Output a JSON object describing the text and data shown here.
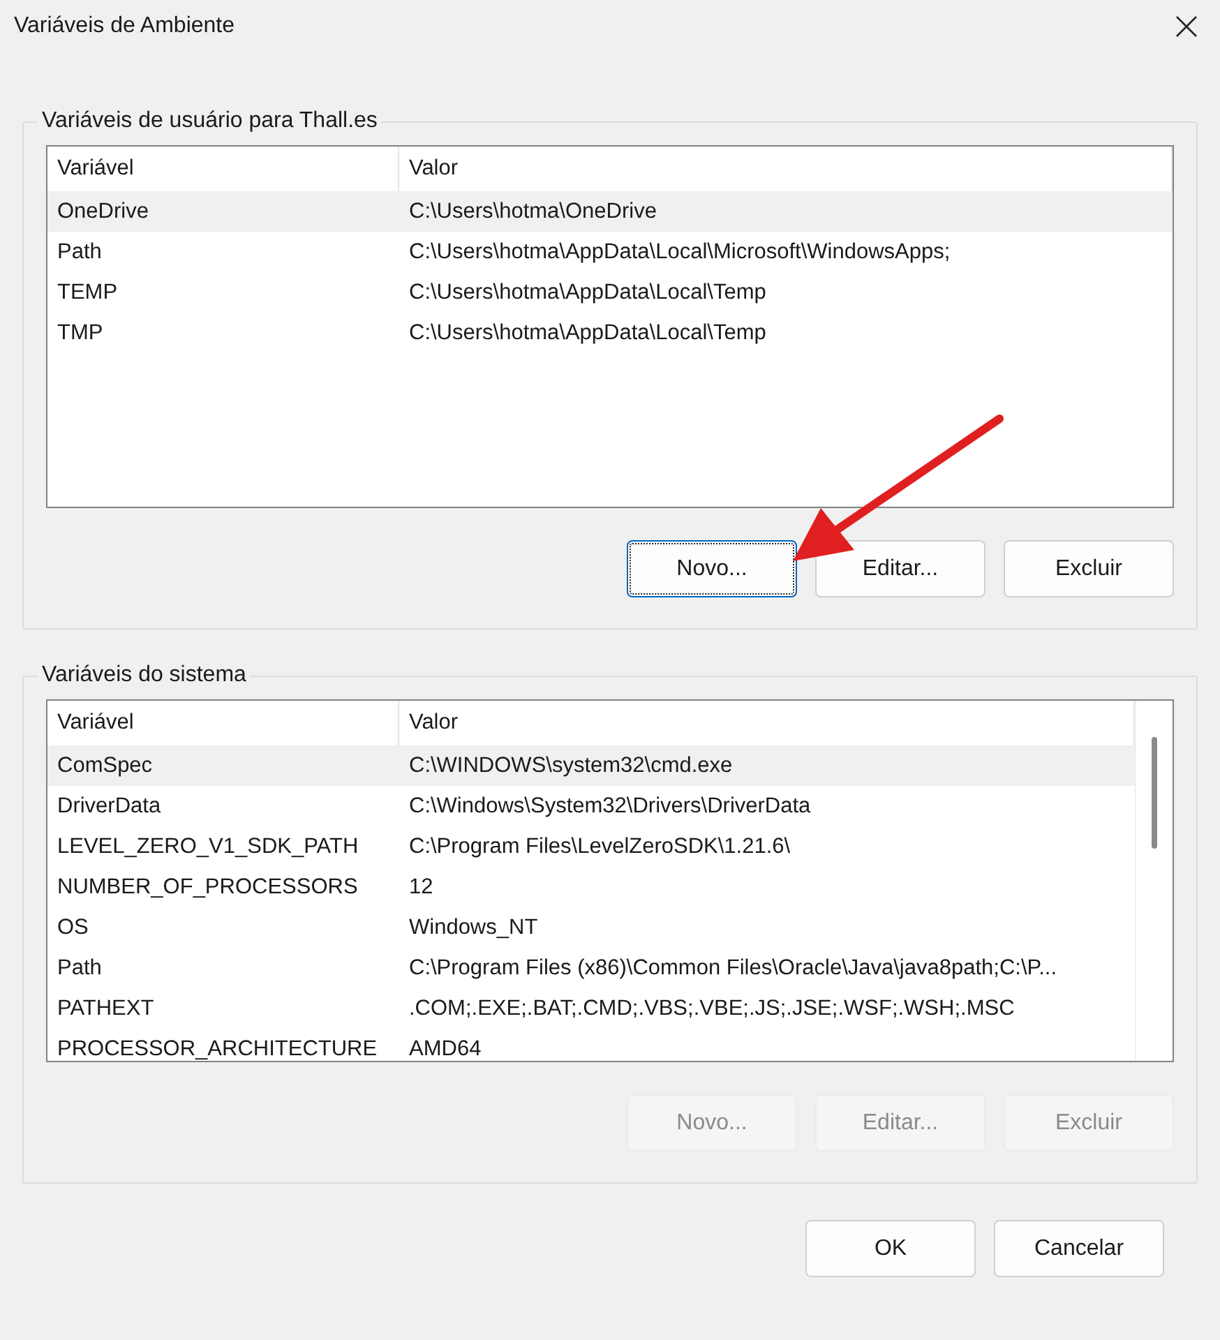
{
  "window": {
    "title": "Variáveis de Ambiente"
  },
  "user_variables": {
    "title": "Variáveis de usuário para Thall.es",
    "columns": [
      "Variável",
      "Valor"
    ],
    "rows": [
      {
        "name": "OneDrive",
        "value": "C:\\Users\\hotma\\OneDrive",
        "selected": true
      },
      {
        "name": "Path",
        "value": "C:\\Users\\hotma\\AppData\\Local\\Microsoft\\WindowsApps;",
        "selected": false
      },
      {
        "name": "TEMP",
        "value": "C:\\Users\\hotma\\AppData\\Local\\Temp",
        "selected": false
      },
      {
        "name": "TMP",
        "value": "C:\\Users\\hotma\\AppData\\Local\\Temp",
        "selected": false
      }
    ],
    "buttons": [
      {
        "label": "Novo...",
        "focused": true,
        "disabled": false
      },
      {
        "label": "Editar...",
        "focused": false,
        "disabled": false
      },
      {
        "label": "Excluir",
        "focused": false,
        "disabled": false
      }
    ]
  },
  "system_variables": {
    "title": "Variáveis do sistema",
    "columns": [
      "Variável",
      "Valor"
    ],
    "rows": [
      {
        "name": "ComSpec",
        "value": "C:\\WINDOWS\\system32\\cmd.exe",
        "selected": true
      },
      {
        "name": "DriverData",
        "value": "C:\\Windows\\System32\\Drivers\\DriverData",
        "selected": false
      },
      {
        "name": "LEVEL_ZERO_V1_SDK_PATH",
        "value": "C:\\Program Files\\LevelZeroSDK\\1.21.6\\",
        "selected": false
      },
      {
        "name": "NUMBER_OF_PROCESSORS",
        "value": "12",
        "selected": false
      },
      {
        "name": "OS",
        "value": "Windows_NT",
        "selected": false
      },
      {
        "name": "Path",
        "value": "C:\\Program Files (x86)\\Common Files\\Oracle\\Java\\java8path;C:\\P...",
        "selected": false
      },
      {
        "name": "PATHEXT",
        "value": ".COM;.EXE;.BAT;.CMD;.VBS;.VBE;.JS;.JSE;.WSF;.WSH;.MSC",
        "selected": false
      },
      {
        "name": "PROCESSOR_ARCHITECTURE",
        "value": "AMD64",
        "selected": false
      }
    ],
    "buttons": [
      {
        "label": "Novo...",
        "focused": false,
        "disabled": true
      },
      {
        "label": "Editar...",
        "focused": false,
        "disabled": true
      },
      {
        "label": "Excluir",
        "focused": false,
        "disabled": true
      }
    ]
  },
  "dialog_buttons": [
    {
      "label": "OK"
    },
    {
      "label": "Cancelar"
    }
  ]
}
